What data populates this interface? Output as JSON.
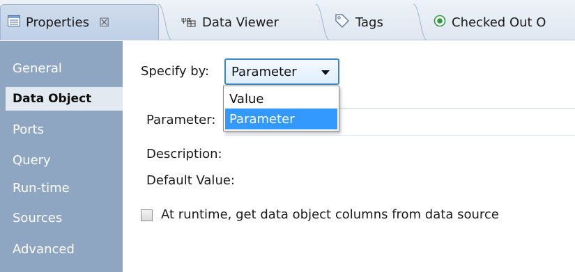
{
  "tabs": [
    {
      "label": "Properties",
      "icon": "properties-icon",
      "active": true,
      "close": "☒"
    },
    {
      "label": "Data Viewer",
      "icon": "data-viewer-icon",
      "active": false
    },
    {
      "label": "Tags",
      "icon": "tag-icon",
      "active": false
    },
    {
      "label": "Checked Out O",
      "icon": "checked-out-icon",
      "active": false
    }
  ],
  "sidebar": {
    "items": [
      {
        "label": "General"
      },
      {
        "label": "Data Object"
      },
      {
        "label": "Ports"
      },
      {
        "label": "Query"
      },
      {
        "label": "Run-time"
      },
      {
        "label": "Sources"
      },
      {
        "label": "Advanced"
      }
    ],
    "selected": "Data Object"
  },
  "form": {
    "specify_by_label": "Specify by:",
    "specify_by_value": "Parameter",
    "dropdown_options": [
      "Value",
      "Parameter"
    ],
    "highlighted_option": "Parameter",
    "parameter_label": "Parameter:",
    "description_label": "Description:",
    "default_value_label": "Default Value:",
    "runtime_checkbox_label": "At runtime, get data object columns from data source",
    "runtime_checkbox_checked": false
  },
  "colors": {
    "sidebar_bg": "#8ea6c2",
    "highlight": "#3399ff",
    "select_border": "#3b86c6"
  }
}
